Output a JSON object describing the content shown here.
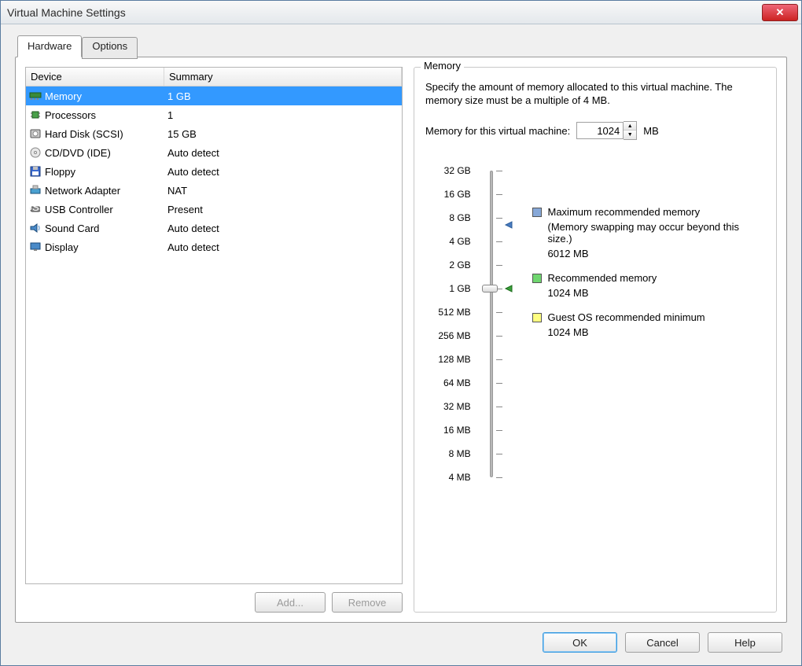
{
  "window": {
    "title": "Virtual Machine Settings"
  },
  "tabs": {
    "hardware": "Hardware",
    "options": "Options"
  },
  "list": {
    "col_device": "Device",
    "col_summary": "Summary",
    "items": [
      {
        "name": "Memory",
        "summary": "1 GB",
        "icon": "memory-icon"
      },
      {
        "name": "Processors",
        "summary": "1",
        "icon": "cpu-icon"
      },
      {
        "name": "Hard Disk (SCSI)",
        "summary": "15 GB",
        "icon": "disk-icon"
      },
      {
        "name": "CD/DVD (IDE)",
        "summary": "Auto detect",
        "icon": "cd-icon"
      },
      {
        "name": "Floppy",
        "summary": "Auto detect",
        "icon": "floppy-icon"
      },
      {
        "name": "Network Adapter",
        "summary": "NAT",
        "icon": "network-icon"
      },
      {
        "name": "USB Controller",
        "summary": "Present",
        "icon": "usb-icon"
      },
      {
        "name": "Sound Card",
        "summary": "Auto detect",
        "icon": "sound-icon"
      },
      {
        "name": "Display",
        "summary": "Auto detect",
        "icon": "display-icon"
      }
    ]
  },
  "left_actions": {
    "add": "Add...",
    "remove": "Remove"
  },
  "memory": {
    "group_label": "Memory",
    "description": "Specify the amount of memory allocated to this virtual machine. The memory size must be a multiple of 4 MB.",
    "input_label": "Memory for this virtual machine:",
    "value": "1024",
    "unit": "MB",
    "ticks": [
      "32 GB",
      "16 GB",
      "8 GB",
      "4 GB",
      "2 GB",
      "1 GB",
      "512 MB",
      "256 MB",
      "128 MB",
      "64 MB",
      "32 MB",
      "16 MB",
      "8 MB",
      "4 MB"
    ],
    "legend": {
      "max_label": "Maximum recommended memory",
      "max_note": "(Memory swapping may occur beyond this size.)",
      "max_value": "6012 MB",
      "rec_label": "Recommended memory",
      "rec_value": "1024 MB",
      "min_label": "Guest OS recommended minimum",
      "min_value": "1024 MB"
    }
  },
  "dialog_actions": {
    "ok": "OK",
    "cancel": "Cancel",
    "help": "Help"
  }
}
